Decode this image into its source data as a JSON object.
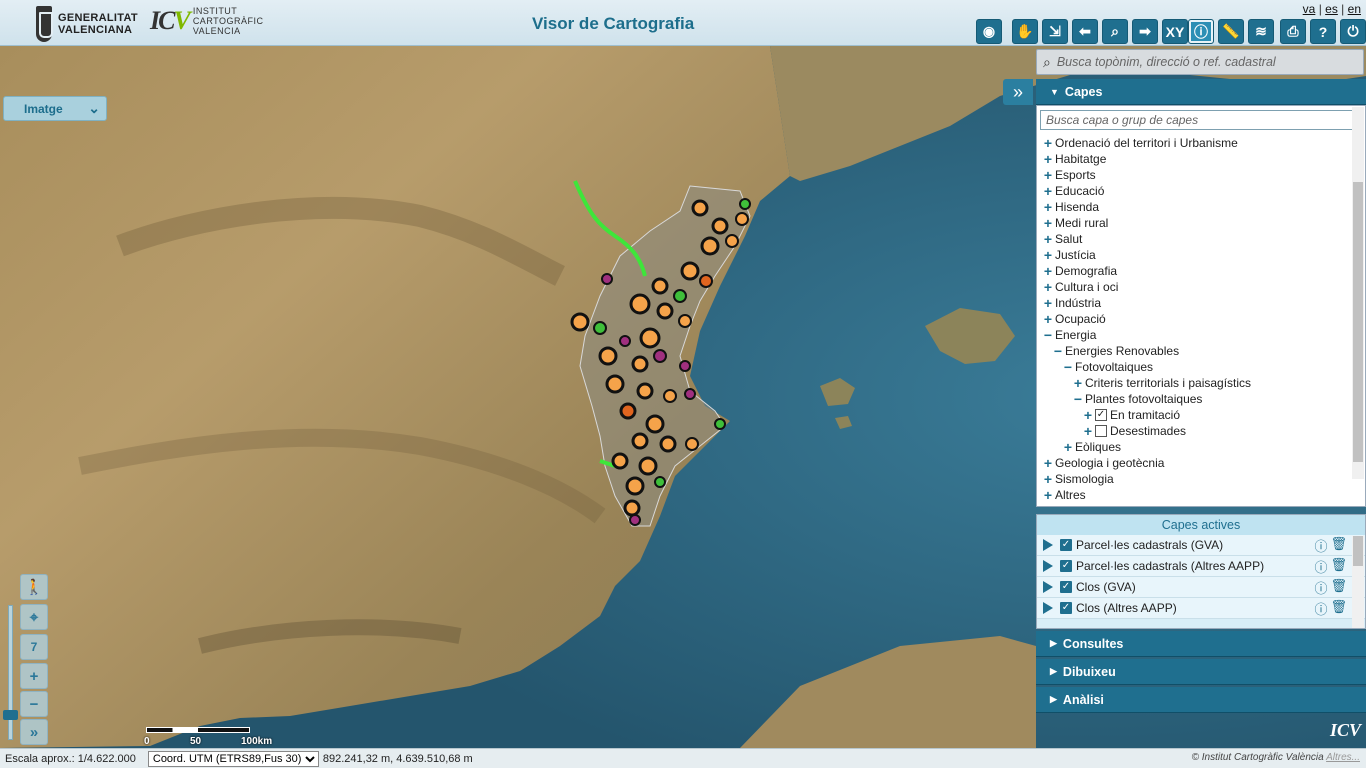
{
  "header": {
    "gv_logo": "GENERALITAT\nVALENCIANA",
    "gv_line1": "GENERALITAT",
    "gv_line2": "VALENCIANA",
    "icv_line1": "INSTITUT",
    "icv_line2": "CARTOGRÀFIC",
    "icv_line3": "VALENCIA",
    "title": "Visor de Cartografia",
    "languages": [
      "va",
      "es",
      "en"
    ],
    "tools": [
      "eye-icon",
      "hand-icon",
      "export-icon",
      "back-icon",
      "zoom-box-icon",
      "forward-icon",
      "xy-label",
      "info-icon",
      "ruler-icon",
      "layers-icon",
      "print-icon",
      "help-icon",
      "close-icon"
    ],
    "xy_label": "XY"
  },
  "map": {
    "basemap_label": "Imatge",
    "zoom_level": "7",
    "scale_labels": [
      "0",
      "50",
      "100km"
    ]
  },
  "panel": {
    "search_placeholder": "Busca topònim, direcció o ref. cadastral",
    "capes_title": "Capes",
    "capes_search_placeholder": "Busca capa o grup de capes",
    "tree": [
      {
        "label": "Ordenació del territori i Urbanisme",
        "level": 0,
        "sign": "+"
      },
      {
        "label": "Habitatge",
        "level": 0,
        "sign": "+"
      },
      {
        "label": "Esports",
        "level": 0,
        "sign": "+"
      },
      {
        "label": "Educació",
        "level": 0,
        "sign": "+"
      },
      {
        "label": "Hisenda",
        "level": 0,
        "sign": "+"
      },
      {
        "label": "Medi rural",
        "level": 0,
        "sign": "+"
      },
      {
        "label": "Salut",
        "level": 0,
        "sign": "+"
      },
      {
        "label": "Justícia",
        "level": 0,
        "sign": "+"
      },
      {
        "label": "Demografia",
        "level": 0,
        "sign": "+"
      },
      {
        "label": "Cultura i oci",
        "level": 0,
        "sign": "+"
      },
      {
        "label": "Indústria",
        "level": 0,
        "sign": "+"
      },
      {
        "label": "Ocupació",
        "level": 0,
        "sign": "+"
      },
      {
        "label": "Energia",
        "level": 0,
        "sign": "−"
      },
      {
        "label": "Energies Renovables",
        "level": 1,
        "sign": "−"
      },
      {
        "label": "Fotovoltaiques",
        "level": 2,
        "sign": "−"
      },
      {
        "label": "Criteris territorials i paisagístics",
        "level": 3,
        "sign": "+"
      },
      {
        "label": "Plantes fotovoltaiques",
        "level": 3,
        "sign": "−"
      },
      {
        "label": "En tramitació",
        "level": 4,
        "sign": "+",
        "checkbox": true,
        "checked": true
      },
      {
        "label": "Desestimades",
        "level": 4,
        "sign": "+",
        "checkbox": true,
        "checked": false
      },
      {
        "label": "Eòliques",
        "level": 2,
        "sign": "+"
      },
      {
        "label": "Geologia i geotècnia",
        "level": 0,
        "sign": "+"
      },
      {
        "label": "Sismologia",
        "level": 0,
        "sign": "+"
      },
      {
        "label": "Altres",
        "level": 0,
        "sign": "+"
      }
    ],
    "active_title": "Capes actives",
    "active_layers": [
      "Parcel·les cadastrals (GVA)",
      "Parcel·les cadastrals (Altres AAPP)",
      "Clos (GVA)",
      "Clos (Altres AAPP)"
    ],
    "sections": [
      "Consultes",
      "Dibuixeu",
      "Anàlisi"
    ]
  },
  "footer": {
    "scale": "Escala aprox.: 1/4.622.000",
    "crs_selected": "Coord. UTM (ETRS89,Fus 30)",
    "coords": "892.241,32 m, 4.639.510,68 m",
    "copyright": "© Institut Cartogràfic València",
    "copyright_link": "Altres..."
  },
  "colors": {
    "accent": "#1f6f8f",
    "sea": "#2f6a85",
    "marker_orange": "#f5a34a",
    "marker_green": "#3fbf3a",
    "marker_purple": "#a0307f"
  }
}
